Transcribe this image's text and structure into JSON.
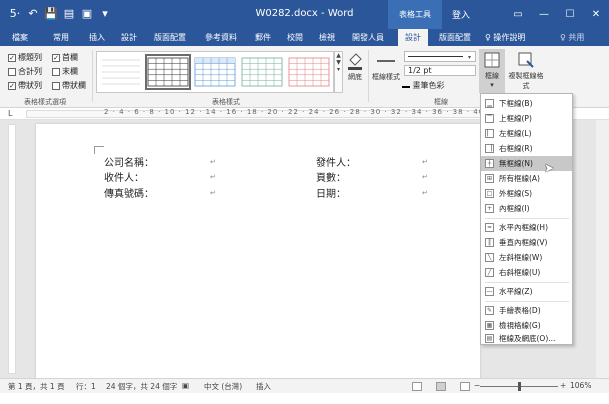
{
  "titlebar": {
    "doc_title": "W0282.docx - Word",
    "context_tools": "表格工具",
    "signin": "登入",
    "qat": [
      "5·",
      "↶",
      "💾",
      "▤",
      "▣",
      "▾"
    ],
    "win": [
      "▭",
      "—",
      "☐",
      "✕"
    ]
  },
  "tabs": [
    {
      "label": "檔案"
    },
    {
      "label": "常用"
    },
    {
      "label": "插入"
    },
    {
      "label": "設計"
    },
    {
      "label": "版面配置"
    },
    {
      "label": "參考資料"
    },
    {
      "label": "郵件"
    },
    {
      "label": "校閱"
    },
    {
      "label": "檢視"
    },
    {
      "label": "開發人員"
    },
    {
      "label": "設計"
    },
    {
      "label": "版面配置"
    }
  ],
  "help": "♀ 操作說明",
  "share": "♀ 共用",
  "ribbon": {
    "style_options": {
      "header_row": "標題列",
      "first_column": "首欄",
      "total_row": "合計列",
      "last_column": "末欄",
      "banded_rows": "帶狀列",
      "banded_columns": "帶狀欄",
      "group_label": "表格樣式選項"
    },
    "table_styles_label": "表格樣式",
    "shading_label": "網底",
    "border_styles_label": "框線樣式",
    "line_weight": "1/2 pt",
    "pen_color": "畫筆色彩",
    "borders_group_label": "框線",
    "borders_button": "框線",
    "border_painter": "複製框線格式",
    "check_mark": "✓"
  },
  "ruler_text": "2 · 4 · 6 · 8 · 10 · 12 · 14 · 16 · 18 · 20 · 22 · 24 · 26 · 28 · 30 · 32 · 34 · 36 · 38 · 40",
  "document": {
    "cells": [
      {
        "text": "公司名稱："
      },
      {
        "text": "收件人："
      },
      {
        "text": "傳真號碼："
      },
      {
        "text": "發件人："
      },
      {
        "text": "頁數："
      },
      {
        "text": "日期："
      }
    ],
    "end_mark": "↵"
  },
  "menu": {
    "items": [
      {
        "label": "下框線(B)",
        "icon": "▁"
      },
      {
        "label": "上框線(P)",
        "icon": "▔"
      },
      {
        "label": "左框線(L)",
        "icon": "▏"
      },
      {
        "label": "右框線(R)",
        "icon": "▕"
      },
      {
        "label": "無框線(N)",
        "icon": "┼"
      },
      {
        "label": "所有框線(A)",
        "icon": "⊞"
      },
      {
        "label": "外框線(S)",
        "icon": "□"
      },
      {
        "label": "內框線(I)",
        "icon": "+"
      },
      {
        "label": "水平內框線(H)",
        "icon": "═"
      },
      {
        "label": "垂直內框線(V)",
        "icon": "║"
      },
      {
        "label": "左斜框線(W)",
        "icon": "╲"
      },
      {
        "label": "右斜框線(U)",
        "icon": "╱"
      },
      {
        "label": "水平線(Z)",
        "icon": "—"
      },
      {
        "label": "手繪表格(D)",
        "icon": "✎"
      },
      {
        "label": "檢視格線(G)",
        "icon": "▦"
      },
      {
        "label": "框線及網底(O)...",
        "icon": "▤"
      }
    ]
  },
  "statusbar": {
    "page": "第 1 頁，共 1 頁",
    "line": "行：1",
    "words": "24 個字，共 24 個字",
    "lang": "中文 (台灣)",
    "mode": "插入",
    "zoom_minus": "−",
    "zoom_plus": "+",
    "zoom": "106%",
    "zoom_level_percent": 106
  }
}
